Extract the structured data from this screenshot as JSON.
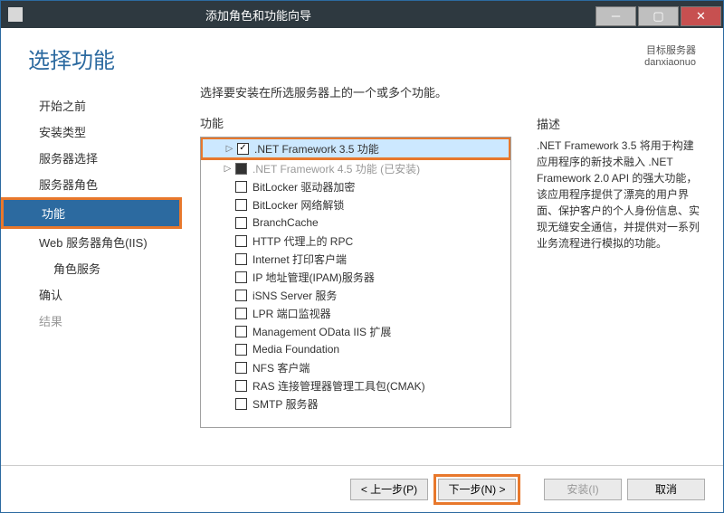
{
  "window": {
    "title": "添加角色和功能向导"
  },
  "header": {
    "page_title": "选择功能",
    "target_label": "目标服务器",
    "target_value": "danxiaonuo"
  },
  "sidebar": {
    "items": [
      {
        "label": "开始之前"
      },
      {
        "label": "安装类型"
      },
      {
        "label": "服务器选择"
      },
      {
        "label": "服务器角色"
      },
      {
        "label": "功能"
      },
      {
        "label": "Web 服务器角色(IIS)"
      },
      {
        "label": "角色服务"
      },
      {
        "label": "确认"
      },
      {
        "label": "结果"
      }
    ]
  },
  "main": {
    "instruction": "选择要安装在所选服务器上的一个或多个功能。",
    "features_label": "功能",
    "features": [
      {
        "label": ".NET Framework 3.5 功能"
      },
      {
        "label": ".NET Framework 4.5 功能 (已安装)"
      },
      {
        "label": "BitLocker 驱动器加密"
      },
      {
        "label": "BitLocker 网络解锁"
      },
      {
        "label": "BranchCache"
      },
      {
        "label": "HTTP 代理上的 RPC"
      },
      {
        "label": "Internet 打印客户端"
      },
      {
        "label": "IP 地址管理(IPAM)服务器"
      },
      {
        "label": "iSNS Server 服务"
      },
      {
        "label": "LPR 端口监视器"
      },
      {
        "label": "Management OData IIS 扩展"
      },
      {
        "label": "Media Foundation"
      },
      {
        "label": "NFS 客户端"
      },
      {
        "label": "RAS 连接管理器管理工具包(CMAK)"
      },
      {
        "label": "SMTP 服务器"
      }
    ]
  },
  "desc": {
    "label": "描述",
    "text": ".NET Framework 3.5 将用于构建应用程序的新技术融入 .NET Framework 2.0 API 的强大功能，该应用程序提供了漂亮的用户界面、保护客户的个人身份信息、实现无缝安全通信，并提供对一系列业务流程进行模拟的功能。"
  },
  "buttons": {
    "prev": "< 上一步(P)",
    "next": "下一步(N) >",
    "install": "安装(I)",
    "cancel": "取消"
  }
}
